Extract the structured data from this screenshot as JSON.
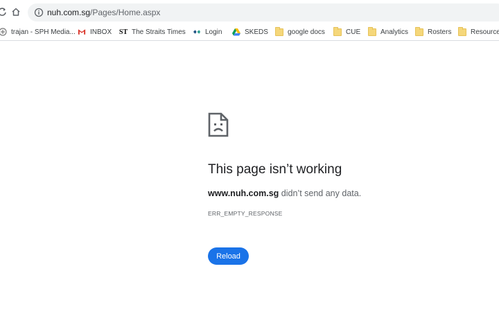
{
  "address_bar": {
    "host": "nuh.com.sg",
    "path": "/Pages/Home.aspx"
  },
  "bookmarks": [
    {
      "label": "trajan - SPH Media...",
      "icon": "trajan-icon"
    },
    {
      "label": "INBOX",
      "icon": "gmail-icon"
    },
    {
      "label": "The Straits Times",
      "icon": "straits-times-icon"
    },
    {
      "label": "Login",
      "icon": "login-icon"
    },
    {
      "label": "SKEDS",
      "icon": "google-drive-icon"
    },
    {
      "label": "google docs",
      "icon": "folder-icon"
    },
    {
      "label": "CUE",
      "icon": "folder-icon"
    },
    {
      "label": "Analytics",
      "icon": "folder-icon"
    },
    {
      "label": "Rosters",
      "icon": "folder-icon"
    },
    {
      "label": "Resources",
      "icon": "folder-icon"
    }
  ],
  "error": {
    "title": "This page isn’t working",
    "host": "www.nuh.com.sg",
    "message": " didn’t send any data.",
    "code": "ERR_EMPTY_RESPONSE",
    "reload_label": "Reload"
  },
  "colors": {
    "accent": "#1a73e8",
    "omnibox_bg": "#f1f3f4",
    "folder": "#f5d77a"
  }
}
